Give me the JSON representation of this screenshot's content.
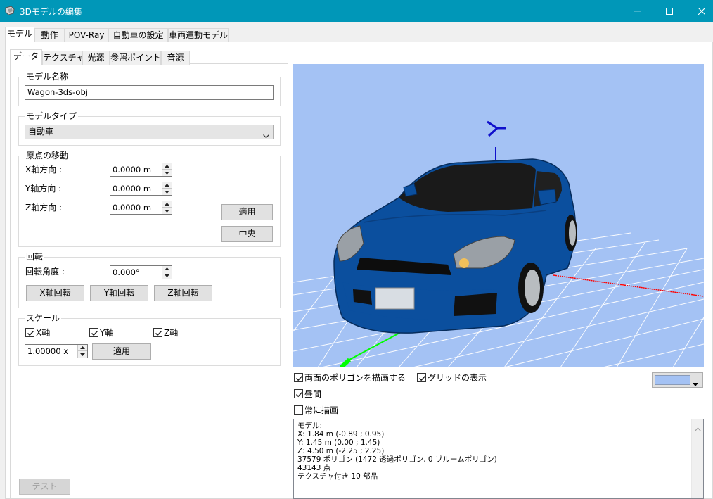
{
  "window": {
    "title": "3Dモデルの編集"
  },
  "top_tabs": [
    "モデル",
    "動作",
    "POV-Ray",
    "自動車の設定",
    "車両運動モデル"
  ],
  "sub_tabs": [
    "データ",
    "テクスチャ",
    "光源",
    "参照ポイント",
    "音源"
  ],
  "model_name": {
    "label": "モデル名称",
    "value": "Wagon-3ds-obj"
  },
  "model_type": {
    "label": "モデルタイプ",
    "value": "自動車"
  },
  "origin": {
    "label": "原点の移動",
    "x_label": "X軸方向 :",
    "y_label": "Y軸方向 :",
    "z_label": "Z軸方向 :",
    "x_value": "0.0000 m",
    "y_value": "0.0000 m",
    "z_value": "0.0000 m",
    "apply_label": "適用",
    "center_label": "中央"
  },
  "rotation": {
    "label": "回転",
    "angle_label": "回転角度 :",
    "angle_value": "0.000°",
    "x_button": "X軸回転",
    "y_button": "Y軸回転",
    "z_button": "Z軸回転"
  },
  "scale": {
    "label": "スケール",
    "x_label": "X軸",
    "y_label": "Y軸",
    "z_label": "Z軸",
    "x_checked": true,
    "y_checked": true,
    "z_checked": true,
    "value": "1.00000 x",
    "apply_label": "適用"
  },
  "test_button": "テスト",
  "options": {
    "double_sided": {
      "label": "両面のポリゴンを描画する",
      "checked": true
    },
    "show_grid": {
      "label": "グリッドの表示",
      "checked": true
    },
    "daytime": {
      "label": "昼間",
      "checked": true
    },
    "always_draw": {
      "label": "常に描画",
      "checked": false
    }
  },
  "background_color": "#a4c2f4",
  "info_lines": [
    "モデル:",
    "X: 1.84 m (-0.89 ; 0.95)",
    "Y: 1.45 m (0.00 ; 1.45)",
    "Z: 4.50 m (-2.25 ; 2.25)",
    "37579 ポリゴン (1472 透過ポリゴン, 0 ブルームポリゴン)",
    "43143 点",
    "テクスチャ付き 10 部品"
  ]
}
